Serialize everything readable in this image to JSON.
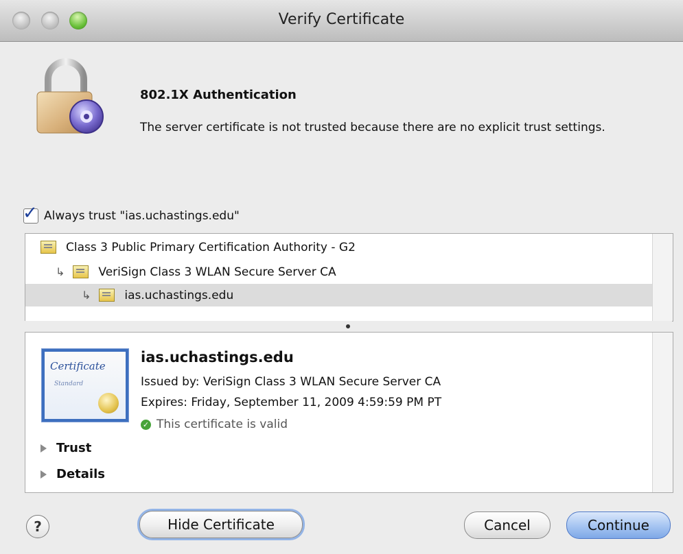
{
  "window": {
    "title": "Verify Certificate"
  },
  "header": {
    "heading": "802.1X Authentication",
    "message": "The server certificate is not trusted because there are no explicit trust settings."
  },
  "trust": {
    "label": "Always trust \"ias.uchastings.edu\"",
    "checked": true
  },
  "chain": [
    {
      "label": "Class 3 Public Primary Certification Authority - G2"
    },
    {
      "label": "VeriSign Class 3 WLAN Secure Server CA"
    },
    {
      "label": "ias.uchastings.edu",
      "selected": true
    }
  ],
  "details": {
    "name": "ias.uchastings.edu",
    "issued_by": "Issued by: VeriSign Class 3 WLAN Secure Server CA",
    "expires": "Expires: Friday, September 11, 2009 4:59:59 PM PT",
    "status": "This certificate is valid",
    "status_color": "#47a339",
    "sections": [
      "Trust",
      "Details"
    ],
    "cert_image_text": "Certificate",
    "cert_image_subtext": "Standard"
  },
  "buttons": {
    "help": "?",
    "hide_certificate": "Hide Certificate",
    "cancel": "Cancel",
    "continue": "Continue"
  },
  "icons": {
    "lock": "lock-icon",
    "certificate": "certificate-icon",
    "valid": "check-circle-icon"
  }
}
